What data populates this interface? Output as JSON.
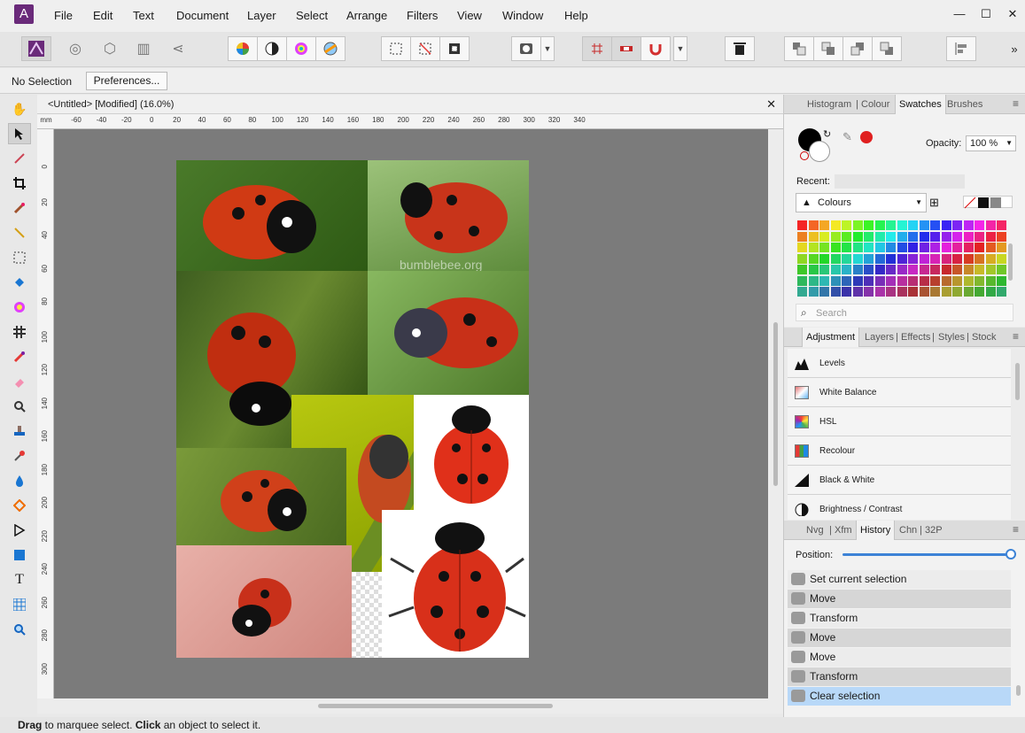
{
  "menu": {
    "logo_glyph": "A",
    "items": [
      "File",
      "Edit",
      "Text",
      "Document",
      "Layer",
      "Select",
      "Arrange",
      "Filters",
      "View",
      "Window",
      "Help"
    ],
    "window_controls": [
      "—",
      "☐",
      "✕"
    ]
  },
  "context_bar": {
    "selection_text": "No Selection",
    "preferences_label": "Preferences..."
  },
  "document": {
    "tab_title": "<Untitled> [Modified] (16.0%)",
    "close_glyph": "✕",
    "ruler_unit": "mm",
    "ruler_x": [
      "-60",
      "-40",
      "-20",
      "0",
      "20",
      "40",
      "60",
      "80",
      "100",
      "120",
      "140",
      "160",
      "180",
      "200",
      "220",
      "240",
      "260",
      "280",
      "300",
      "320",
      "340"
    ],
    "ruler_y": [
      "0",
      "20",
      "40",
      "60",
      "80",
      "100",
      "120",
      "140",
      "160",
      "180",
      "200",
      "220",
      "240",
      "260",
      "280",
      "300"
    ]
  },
  "artboard": {
    "watermark_text": "bumblebee.org"
  },
  "panel_swatches": {
    "tabs": [
      "Histogram",
      "Colour",
      "Swatches",
      "Brushes"
    ],
    "active_tab": "Swatches",
    "opacity_label": "Opacity:",
    "opacity_value": "100 %",
    "recent_label": "Recent:",
    "palette_name": "Colours",
    "search_placeholder": "Search",
    "menu_glyph": "≡"
  },
  "panel_adjustment": {
    "tabs": [
      "Adjustment",
      "Layers",
      "Effects",
      "Styles",
      "Stock"
    ],
    "active_tab": "Adjustment",
    "items": [
      "Levels",
      "White Balance",
      "HSL",
      "Recolour",
      "Black & White",
      "Brightness / Contrast"
    ]
  },
  "panel_history": {
    "tabs": [
      "Nvg",
      "Xfm",
      "History",
      "Chn",
      "32P"
    ],
    "active_tab": "History",
    "position_label": "Position:",
    "position_fraction": 1.0,
    "items": [
      "Set current selection",
      "Move",
      "Transform",
      "Move",
      "Move",
      "Transform",
      "Clear selection"
    ],
    "selected_index": 6
  },
  "status_bar": {
    "drag_word": "Drag",
    "drag_text": " to marquee select. ",
    "click_word": "Click",
    "click_text": " an object to select it."
  },
  "colors": {
    "accent": "#3d83d6",
    "history_selected": "#b8d8f8",
    "canvas_bg": "#7b7b7b",
    "brand": "#6a2a7a"
  }
}
